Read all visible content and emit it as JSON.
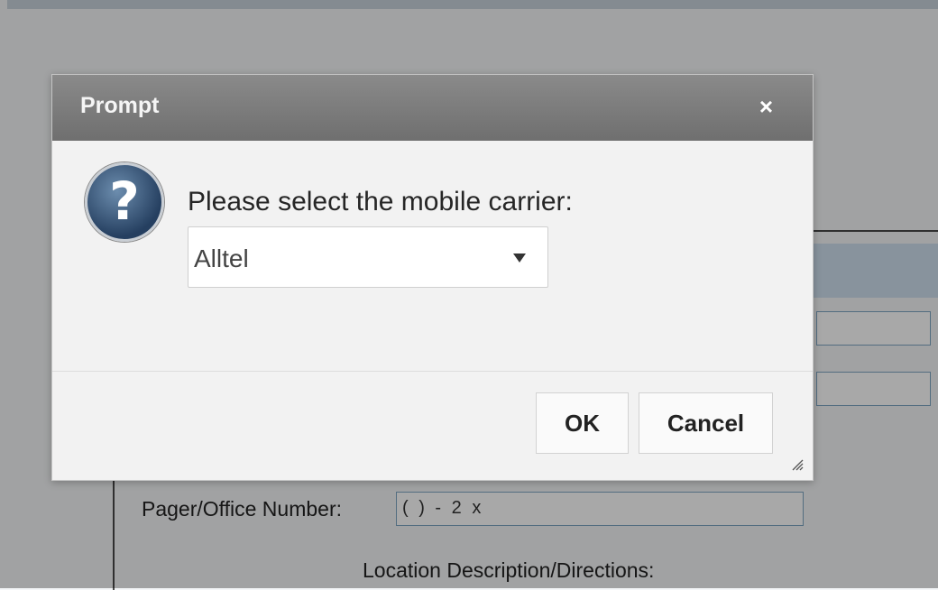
{
  "background": {
    "pager_label": "Pager/Office Number:",
    "pager_value": "( )  -  2 x",
    "location_label": "Location Description/Directions:"
  },
  "dialog": {
    "title": "Prompt",
    "close_glyph": "×",
    "icon": "question-icon",
    "icon_glyph": "?",
    "message": "Please select the mobile carrier:",
    "carrier_select": {
      "selected": "Alltel"
    },
    "ok_label": "OK",
    "cancel_label": "Cancel"
  }
}
